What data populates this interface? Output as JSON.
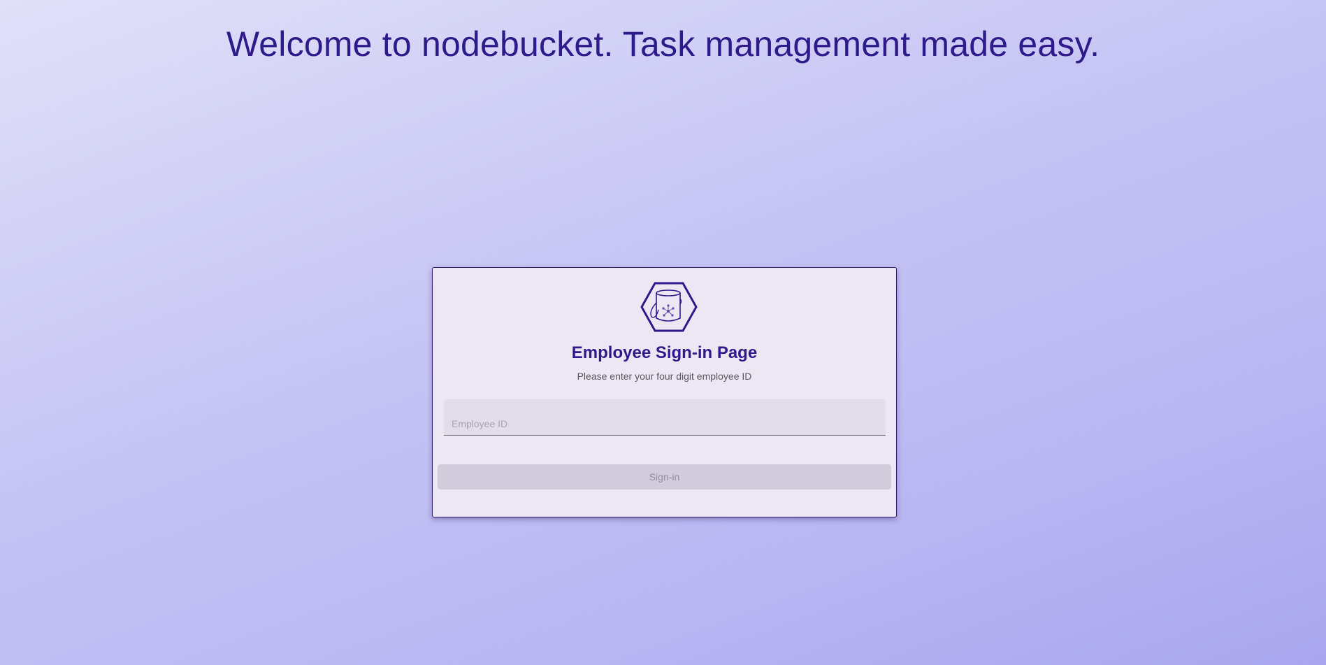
{
  "header": {
    "headline": "Welcome to nodebucket. Task management made easy."
  },
  "signin_card": {
    "logo_icon": "bucket-hexagon-icon",
    "title": "Employee Sign-in Page",
    "subtitle": "Please enter your four digit employee ID",
    "employee_id": {
      "value": "",
      "placeholder": "Employee ID"
    },
    "signin_label": "Sign-in",
    "signin_enabled": false
  },
  "colors": {
    "brand": "#2e1a8a",
    "card_background": "#ede7f4",
    "button_disabled": "#d1ccdb"
  }
}
